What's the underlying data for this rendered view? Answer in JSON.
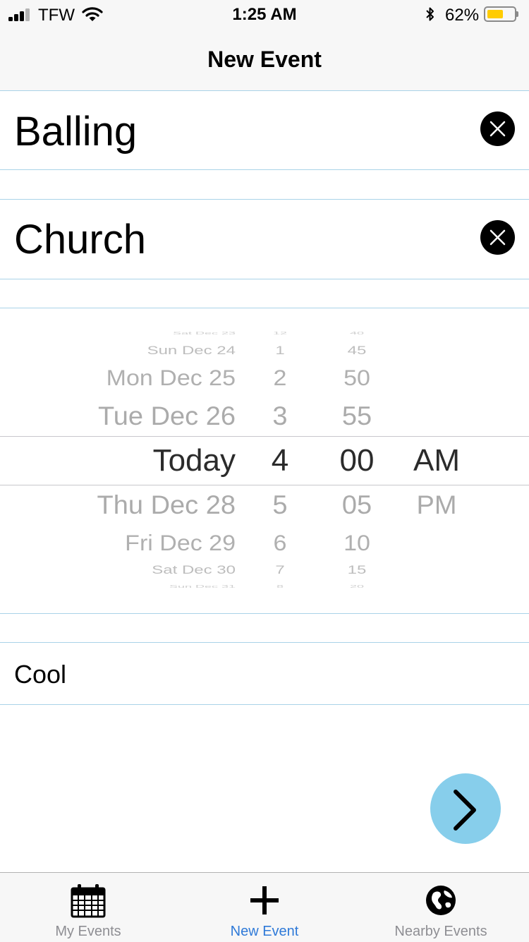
{
  "status_bar": {
    "carrier": "TFW",
    "time": "1:25 AM",
    "battery_percent": "62%",
    "battery_level": 0.62,
    "signal_bars_filled": 3,
    "signal_bars_total": 4
  },
  "nav": {
    "title": "New Event"
  },
  "form": {
    "event_name": {
      "value": "Balling"
    },
    "location": {
      "value": "Church"
    },
    "notes": {
      "value": "Cool"
    }
  },
  "picker": {
    "date_column": [
      "Sat Dec 23",
      "Sun Dec 24",
      "Mon Dec 25",
      "Tue Dec 26",
      "Today",
      "Thu Dec 28",
      "Fri Dec 29",
      "Sat Dec 30",
      "Sun Dec 31"
    ],
    "hour_column": [
      "12",
      "1",
      "2",
      "3",
      "4",
      "5",
      "6",
      "7",
      "8"
    ],
    "minute_column": [
      "40",
      "45",
      "50",
      "55",
      "00",
      "05",
      "10",
      "15",
      "20"
    ],
    "ampm_column": [
      "",
      "",
      "",
      "",
      "AM",
      "PM",
      "",
      "",
      ""
    ],
    "selected_index": 4
  },
  "tabs": [
    {
      "label": "My Events",
      "icon": "calendar-icon",
      "active": false
    },
    {
      "label": "New Event",
      "icon": "plus-icon",
      "active": true
    },
    {
      "label": "Nearby Events",
      "icon": "globe-icon",
      "active": false
    }
  ],
  "colors": {
    "accent_blue": "#2f7ad8",
    "next_button": "#87ceeb",
    "separator": "#a9d3e8",
    "battery_fill": "#ffcc00"
  }
}
